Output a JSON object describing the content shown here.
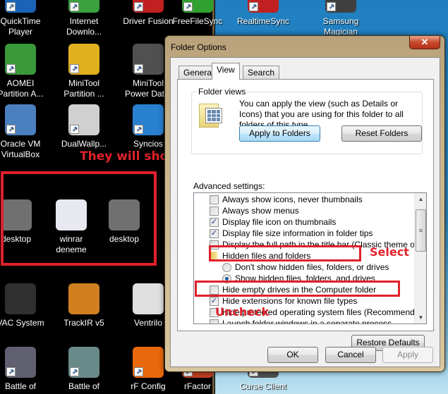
{
  "desktop": {
    "icons": [
      {
        "label": "QuickTime\nPlayer",
        "color": "#1b63b8"
      },
      {
        "label": "Internet\nDownlo...",
        "color": "#3aa040"
      },
      {
        "label": "Driver Fusion",
        "color": "#c02020"
      },
      {
        "label": "FreeFileSync",
        "color": "#30a030"
      },
      {
        "label": "RealtimeSync",
        "color": "#c02020"
      },
      {
        "label": "Samsung\nMagician",
        "color": "#404040"
      },
      {
        "label": "AOMEI\nPartition A...",
        "color": "#3a9a3a"
      },
      {
        "label": "MiniTool\nPartition ...",
        "color": "#e0b020"
      },
      {
        "label": "MiniTool\nPower Dat...",
        "color": "#505050"
      },
      {
        "label": "Oracle VM\nVirtualBox",
        "color": "#4a80c0"
      },
      {
        "label": "DualWallp...",
        "color": "#d0d0d0"
      },
      {
        "label": "Syncios",
        "color": "#2a80d0"
      },
      {
        "label": "desktop",
        "color": "#707070"
      },
      {
        "label": "winrar\ndeneme",
        "color": "#e8e8f0"
      },
      {
        "label": "desktop",
        "color": "#707070"
      },
      {
        "label": "VAC System",
        "color": "#303030"
      },
      {
        "label": "TrackIR v5",
        "color": "#d08020"
      },
      {
        "label": "Ventrilo",
        "color": "#e0e0e0"
      },
      {
        "label": "Battle of",
        "color": "#606070"
      },
      {
        "label": "Battle of",
        "color": "#6a8a8a"
      },
      {
        "label": "rF Config",
        "color": "#e8680c"
      },
      {
        "label": "rFactor",
        "color": "#c04020"
      },
      {
        "label": "Curse Client",
        "color": "#505050"
      }
    ]
  },
  "annotations": {
    "show_on_desktop": "They will show on desktop",
    "select": "Select",
    "uncheck": "Uncheck"
  },
  "dialog": {
    "title": "Folder Options",
    "close_glyph": "✕",
    "tabs": [
      "General",
      "View",
      "Search"
    ],
    "active_tab": "View",
    "folder_views": {
      "label": "Folder views",
      "description": "You can apply the view (such as Details or Icons) that you are using for this folder to all folders of this type.",
      "apply_button": "Apply to Folders",
      "reset_button": "Reset Folders"
    },
    "advanced_label": "Advanced settings:",
    "settings": [
      {
        "type": "checkbox",
        "label": "Always show icons, never thumbnails",
        "checked": false,
        "indent": 1
      },
      {
        "type": "checkbox",
        "label": "Always show menus",
        "checked": false,
        "indent": 1
      },
      {
        "type": "checkbox",
        "label": "Display file icon on thumbnails",
        "checked": true,
        "indent": 1
      },
      {
        "type": "checkbox",
        "label": "Display file size information in folder tips",
        "checked": true,
        "indent": 1
      },
      {
        "type": "checkbox",
        "label": "Display the full path in the title bar (Classic theme only)",
        "checked": false,
        "indent": 1
      },
      {
        "type": "folder",
        "label": "Hidden files and folders",
        "indent": 1
      },
      {
        "type": "radio",
        "label": "Don't show hidden files, folders, or drives",
        "checked": false,
        "indent": 2
      },
      {
        "type": "radio",
        "label": "Show hidden files, folders, and drives",
        "checked": true,
        "indent": 2
      },
      {
        "type": "checkbox",
        "label": "Hide empty drives in the Computer folder",
        "checked": false,
        "indent": 1
      },
      {
        "type": "checkbox",
        "label": "Hide extensions for known file types",
        "checked": true,
        "indent": 1
      },
      {
        "type": "checkbox",
        "label": "Hide protected operating system files (Recommended)",
        "checked": false,
        "indent": 1
      },
      {
        "type": "checkbox",
        "label": "Launch folder windows in a separate process",
        "checked": false,
        "indent": 1
      }
    ],
    "restore_button": "Restore Defaults",
    "ok_button": "OK",
    "cancel_button": "Cancel",
    "apply_button": "Apply"
  }
}
